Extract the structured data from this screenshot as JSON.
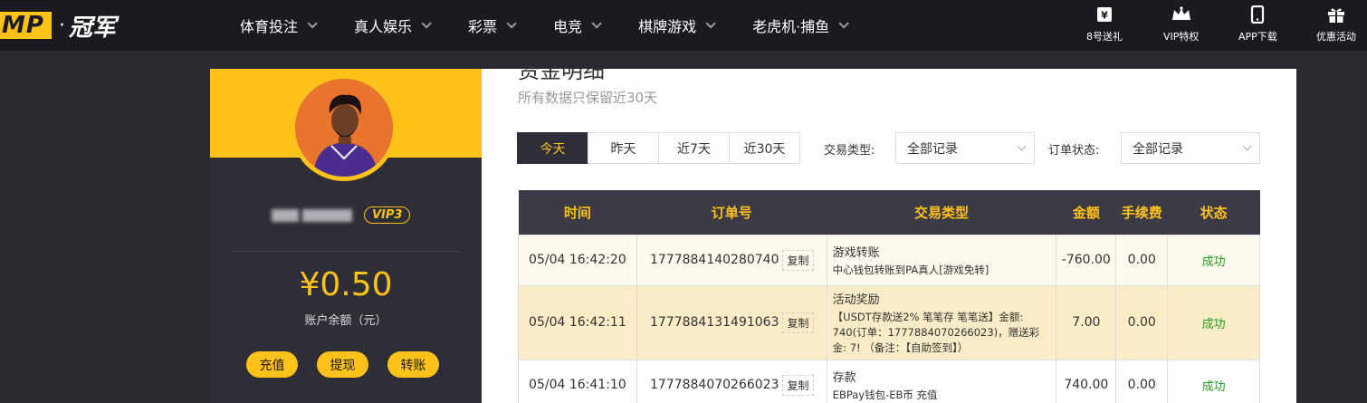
{
  "brand": {
    "logo_box": "MP",
    "logo_text": "冠军"
  },
  "nav": [
    {
      "label": "体育投注"
    },
    {
      "label": "真人娱乐"
    },
    {
      "label": "彩票"
    },
    {
      "label": "电竞"
    },
    {
      "label": "棋牌游戏"
    },
    {
      "label": "老虎机·捕鱼"
    }
  ],
  "quick_links": [
    {
      "label": "8号送礼",
      "icon": "gift-card-icon"
    },
    {
      "label": "VIP特权",
      "icon": "crown-icon"
    },
    {
      "label": "APP下载",
      "icon": "phone-icon"
    },
    {
      "label": "优惠活动",
      "icon": "gift-icon"
    }
  ],
  "profile": {
    "vip": "VIP3",
    "balance": "¥0.50",
    "balance_label": "账户余额（元）",
    "actions": [
      "充值",
      "提现",
      "转账"
    ]
  },
  "main": {
    "title": "资金明细",
    "note": "所有数据只保留近30天",
    "tabs": [
      "今天",
      "昨天",
      "近7天",
      "近30天"
    ],
    "filters": {
      "type_label": "交易类型:",
      "type_value": "全部记录",
      "status_label": "订单状态:",
      "status_value": "全部记录"
    },
    "table": {
      "headers": [
        "时间",
        "订单号",
        "交易类型",
        "金额",
        "手续费",
        "状态"
      ],
      "copy_label": "复制",
      "rows": [
        {
          "time": "05/04 16:42:20",
          "order": "1777884140280740",
          "type_main": "游戏转账",
          "type_sub": "中心钱包转账到PA真人[游戏免转]",
          "amount": "-760.00",
          "fee": "0.00",
          "status": "成功"
        },
        {
          "time": "05/04 16:42:11",
          "order": "1777884131491063",
          "type_main": "活动奖励",
          "type_sub": "【USDT存款送2% 笔笔存 笔笔送】金额: 740(订单：1777884070266023)，赠送彩金: 7! （备注：【自助签到】）",
          "amount": "7.00",
          "fee": "0.00",
          "status": "成功"
        },
        {
          "time": "05/04 16:41:10",
          "order": "1777884070266023",
          "type_main": "存款",
          "type_sub": "EBPay钱包-EB币 充值",
          "amount": "740.00",
          "fee": "0.00",
          "status": "成功"
        }
      ]
    }
  },
  "colors": {
    "accent": "#ffc21a",
    "dark": "#2f2e38",
    "success": "#1ba31b"
  }
}
